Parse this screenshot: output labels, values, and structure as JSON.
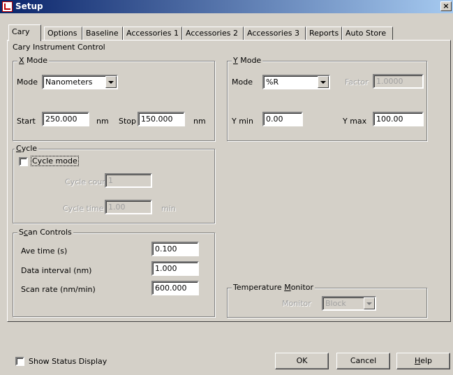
{
  "window": {
    "title": "Setup",
    "close_glyph": "×"
  },
  "tabs": [
    {
      "label": "Cary",
      "active": true
    },
    {
      "label": "Options"
    },
    {
      "label": "Baseline"
    },
    {
      "label": "Accessories 1"
    },
    {
      "label": "Accessories 2"
    },
    {
      "label": "Accessories 3"
    },
    {
      "label": "Reports"
    },
    {
      "label": "Auto Store"
    }
  ],
  "panel_title": "Cary Instrument Control",
  "x_mode": {
    "title_mnemonic": "X",
    "title_rest": " Mode",
    "mode_label": "Mode",
    "mode_value": "Nanometers",
    "start_label": "Start",
    "start_value": "250.000",
    "start_unit": "nm",
    "stop_label": "Stop",
    "stop_value": "150.000",
    "stop_unit": "nm"
  },
  "y_mode": {
    "title_mnemonic": "Y",
    "title_rest": " Mode",
    "mode_label": "Mode",
    "mode_value": "%R",
    "factor_label": "Factor",
    "factor_value": "1.0000",
    "ymin_label": "Y min",
    "ymin_value": "0.00",
    "ymax_label": "Y max",
    "ymax_value": "100.00"
  },
  "cycle": {
    "title_mnemonic": "C",
    "title_rest": "ycle",
    "cycle_mode_label": "Cycle mode",
    "cycle_mode_checked": false,
    "count_label": "Cycle count",
    "count_value": "1",
    "time_label": "Cycle time",
    "time_value": "1.00",
    "time_unit": "min"
  },
  "scan_controls": {
    "title_pre": "S",
    "title_mnemonic": "c",
    "title_rest": "an Controls",
    "ave_time_label": "Ave time (s)",
    "ave_time_value": "0.100",
    "data_interval_label": "Data interval (nm)",
    "data_interval_value": "1.000",
    "scan_rate_label": "Scan rate (nm/min)",
    "scan_rate_value": "600.000"
  },
  "temperature_monitor": {
    "title_pre": "Temperature ",
    "title_mnemonic": "M",
    "title_rest": "onitor",
    "monitor_label": "Monitor",
    "monitor_value": "Block"
  },
  "footer": {
    "show_status_label": "Show Status Display",
    "show_status_checked": false,
    "ok_label": "OK",
    "cancel_label": "Cancel",
    "help_mnemonic": "H",
    "help_rest": "elp"
  },
  "colors": {
    "titlebar_start": "#0a246a",
    "titlebar_end": "#a6caf0",
    "face": "#d4d0c8"
  }
}
